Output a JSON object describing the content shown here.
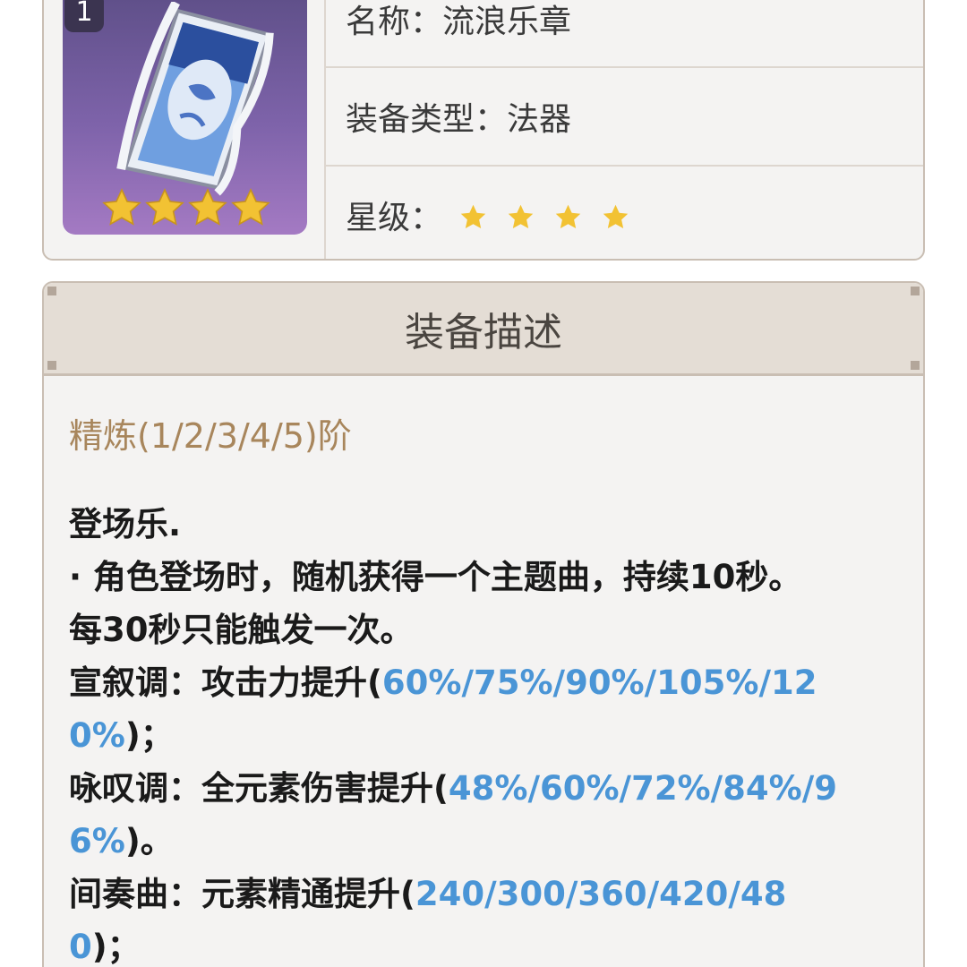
{
  "weapon": {
    "refinement_badge": "1",
    "name_label": "名称：",
    "name": "流浪乐章",
    "type_label": "装备类型：",
    "type": "法器",
    "rarity_label": "星级：",
    "rarity": 4,
    "icon": "catalyst-scroll-icon"
  },
  "description": {
    "header": "装备描述",
    "refinement_text": "精炼(1/2/3/4/5)阶",
    "lines": {
      "l1": "登场乐.",
      "l2": "· 角色登场时，随机获得一个主题曲，持续10秒。",
      "l3": "每30秒只能触发一次。",
      "l4_prefix": "宣叙调：攻击力提升(",
      "l4_value_a": "60%/75%/90%/105%/12",
      "l5_value_b": "0%",
      "l5_suffix": ")；",
      "l6_prefix": "咏叹调：全元素伤害提升(",
      "l6_value_a": "48%/60%/72%/84%/9",
      "l7_value_b": "6%",
      "l7_suffix": ")。",
      "l8_prefix": "间奏曲：元素精通提升(",
      "l8_value_a": "240/300/360/420/48",
      "l9_value_b": "0",
      "l9_suffix": ")；"
    }
  },
  "colors": {
    "star": "#f2c233",
    "highlight": "#4a95d6",
    "refinement": "#a8865c",
    "thumb_bg": "#7e63aa"
  }
}
